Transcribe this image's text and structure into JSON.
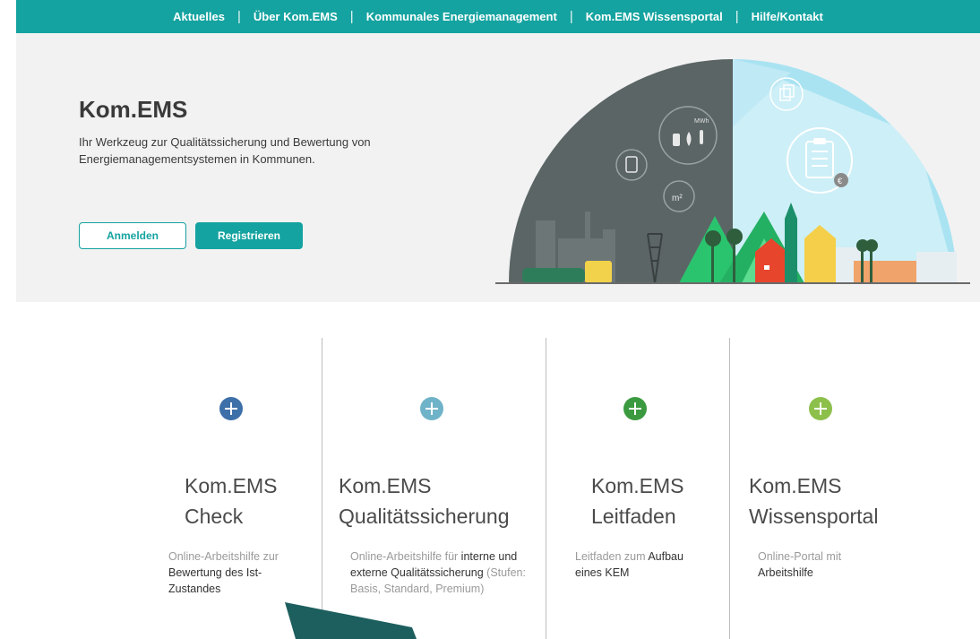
{
  "nav": {
    "items": [
      "Aktuelles",
      "Über Kom.EMS",
      "Kommunales Energiemanagement",
      "Kom.EMS Wissensportal",
      "Hilfe/Kontakt"
    ],
    "separator": "|"
  },
  "hero": {
    "title": "Kom.EMS",
    "subtitle": "Ihr Werkzeug zur Qualitätssicherung und Bewertung von Energiemanagementsystemen in Kommunen.",
    "login_label": "Anmelden",
    "register_label": "Registrieren",
    "illustration": {
      "mwh_label": "MWh",
      "m2_label": "m²",
      "icons": [
        "copy-icon",
        "clipboard-list-icon",
        "euro-coin-icon",
        "calculator-icon",
        "plug-drop-thermometer-icon"
      ]
    }
  },
  "columns": [
    {
      "icon": "plus-circle-icon",
      "color": "#3d6fa8",
      "title_line1": "Kom.EMS",
      "title_line2": "Check",
      "desc": [
        {
          "text": "Online-Arbeitshilfe zur ",
          "em": false
        },
        {
          "text": "Bewertung des Ist-Zustandes",
          "em": true
        }
      ]
    },
    {
      "icon": "plus-circle-icon",
      "color": "#6fb3c8",
      "title_line1": "Kom.EMS",
      "title_line2": "Qualitätssicherung",
      "desc": [
        {
          "text": "Online-Arbeitshilfe für ",
          "em": false
        },
        {
          "text": "interne und externe Qualitätssicherung",
          "em": true
        },
        {
          "text": " (Stufen: Basis, Standard, Premium)",
          "em": false
        }
      ]
    },
    {
      "icon": "plus-circle-icon",
      "color": "#3b9a3f",
      "title_line1": "Kom.EMS",
      "title_line2": "Leitfaden",
      "desc": [
        {
          "text": "Leitfaden zum ",
          "em": false
        },
        {
          "text": "Aufbau eines KEM",
          "em": true
        }
      ]
    },
    {
      "icon": "plus-circle-icon",
      "color": "#8cc04b",
      "title_line1": "Kom.EMS",
      "title_line2": "Wissensportal",
      "desc": [
        {
          "text": "Online-Portal mit ",
          "em": false
        },
        {
          "text": "Arbeitshilfe",
          "em": true
        }
      ]
    }
  ],
  "colors": {
    "accent": "#14a3a0",
    "hero_bg": "#f2f2f2"
  }
}
